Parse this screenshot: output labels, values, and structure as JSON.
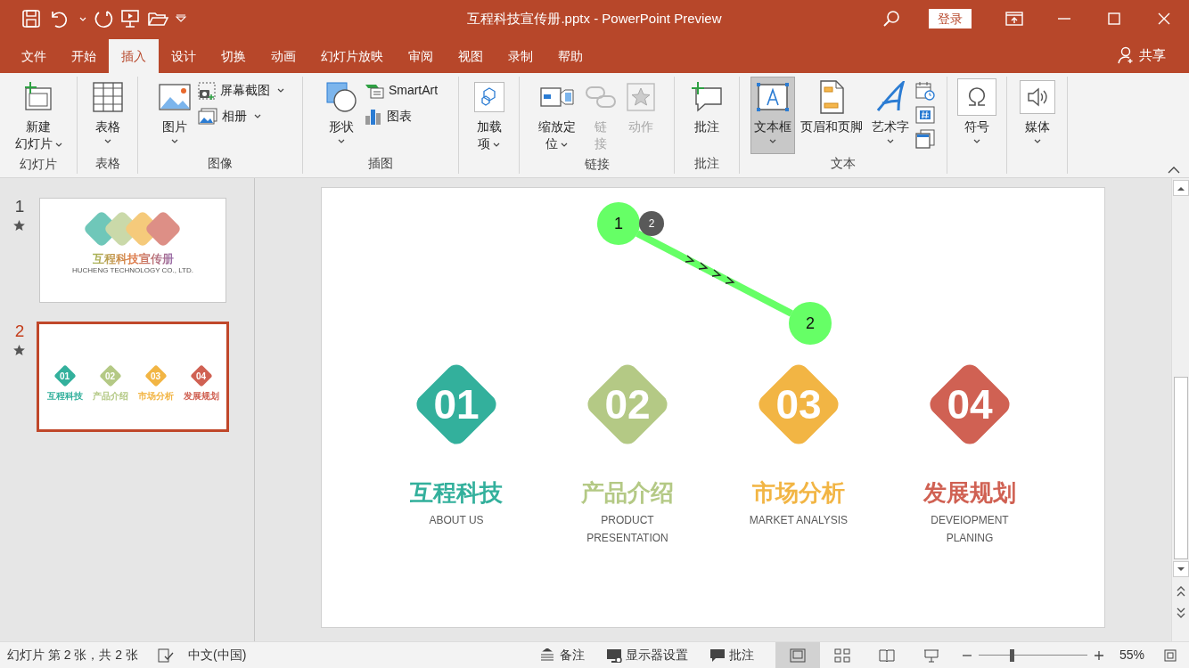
{
  "title_bar": {
    "title": "互程科技宣传册.pptx  -  PowerPoint Preview",
    "sign_in": "登录"
  },
  "menu_tabs": [
    {
      "label": "文件",
      "selected": false
    },
    {
      "label": "开始",
      "selected": false
    },
    {
      "label": "插入",
      "selected": true
    },
    {
      "label": "设计",
      "selected": false
    },
    {
      "label": "切换",
      "selected": false
    },
    {
      "label": "动画",
      "selected": false
    },
    {
      "label": "幻灯片放映",
      "selected": false
    },
    {
      "label": "审阅",
      "selected": false
    },
    {
      "label": "视图",
      "selected": false
    },
    {
      "label": "录制",
      "selected": false
    },
    {
      "label": "帮助",
      "selected": false
    }
  ],
  "share": "共享",
  "ribbon": {
    "groups": [
      {
        "label": "幻灯片",
        "buttons": [
          {
            "kind": "large",
            "label": [
              "新建",
              "幻灯片"
            ],
            "dropdown": true,
            "disabled": false,
            "selected": false
          }
        ]
      },
      {
        "label": "表格",
        "buttons": [
          {
            "kind": "large",
            "label": "表格",
            "dropdown": true,
            "disabled": false,
            "selected": false
          }
        ]
      },
      {
        "label": "图像",
        "buttons": [
          {
            "kind": "large",
            "label": "图片",
            "dropdown": true,
            "disabled": false,
            "selected": false
          },
          {
            "kind": "small",
            "label": "屏幕截图",
            "dropdown": true,
            "disabled": false,
            "selected": false
          },
          {
            "kind": "small",
            "label": "相册",
            "dropdown": true,
            "disabled": false,
            "selected": false
          }
        ]
      },
      {
        "label": "插图",
        "buttons": [
          {
            "kind": "large",
            "label": "形状",
            "dropdown": true,
            "disabled": false,
            "selected": false
          },
          {
            "kind": "small",
            "label": "SmartArt",
            "dropdown": false,
            "disabled": false,
            "selected": false
          },
          {
            "kind": "small",
            "label": "图表",
            "dropdown": false,
            "disabled": false,
            "selected": false
          }
        ]
      },
      {
        "buttons": [
          {
            "kind": "large",
            "label": [
              "加载",
              "项"
            ],
            "dropdown": true,
            "disabled": false,
            "selected": false
          }
        ]
      },
      {
        "label": "链接",
        "buttons": [
          {
            "kind": "large",
            "label": [
              "缩放定",
              "位"
            ],
            "dropdown": true,
            "disabled": false,
            "selected": false
          },
          {
            "kind": "large",
            "label": [
              "链",
              "接"
            ],
            "dropdown": false,
            "disabled": true,
            "selected": false
          },
          {
            "kind": "large",
            "label": "动作",
            "dropdown": false,
            "disabled": true,
            "selected": false
          }
        ]
      },
      {
        "label": "批注",
        "buttons": [
          {
            "kind": "large",
            "label": "批注",
            "dropdown": false,
            "disabled": false,
            "selected": false
          }
        ]
      },
      {
        "label": "文本",
        "buttons": [
          {
            "kind": "large",
            "label": "文本框",
            "dropdown": true,
            "disabled": false,
            "selected": true
          },
          {
            "kind": "large",
            "label": "页眉和页脚",
            "dropdown": false,
            "disabled": false,
            "selected": false
          },
          {
            "kind": "large",
            "label": "艺术字",
            "dropdown": true,
            "disabled": false,
            "selected": false
          },
          {
            "kind": "icon",
            "dropdown": false,
            "disabled": false,
            "selected": false
          },
          {
            "kind": "icon",
            "dropdown": false,
            "disabled": false,
            "selected": false
          },
          {
            "kind": "icon",
            "dropdown": false,
            "disabled": false,
            "selected": false
          }
        ]
      },
      {
        "buttons": [
          {
            "kind": "large",
            "label": "符号",
            "dropdown": true,
            "disabled": false,
            "selected": false
          }
        ]
      },
      {
        "buttons": [
          {
            "kind": "large",
            "label": "媒体",
            "dropdown": true,
            "disabled": false,
            "selected": false
          }
        ]
      }
    ]
  },
  "slides_panel": [
    {
      "number": "1",
      "selected": false,
      "thumbnail": {
        "kind": "cover",
        "title": "互程科技宣传册",
        "subtitle": "HUCHENG TECHNOLOGY CO., LTD."
      }
    },
    {
      "number": "2",
      "selected": true,
      "thumbnail": {
        "kind": "items",
        "items": [
          {
            "number": "01",
            "title": "互程科技",
            "color": "#33b09c"
          },
          {
            "number": "02",
            "title": "产品介绍",
            "color": "#b4c985"
          },
          {
            "number": "03",
            "title": "市场分析",
            "color": "#f2b544"
          },
          {
            "number": "04",
            "title": "发展规划",
            "color": "#d06153"
          }
        ]
      }
    }
  ],
  "slide": {
    "items": [
      {
        "number": "01",
        "title": "互程科技",
        "subtitle": "ABOUT US",
        "color": "#33b09c"
      },
      {
        "number": "02",
        "title": "产品介绍",
        "subtitle": "PRODUCT\nPRESENTATION",
        "color": "#b4c985"
      },
      {
        "number": "03",
        "title": "市场分析",
        "subtitle": "MARKET ANALYSIS",
        "color": "#f2b544"
      },
      {
        "number": "04",
        "title": "发展规划",
        "subtitle": "DEVEIOPMENT\nPLANING",
        "color": "#d06153"
      }
    ],
    "animation": {
      "start": "1",
      "end": "2",
      "badge": "2"
    }
  },
  "status_bar": {
    "slide_info": "幻灯片 第 2 张，共 2 张",
    "language": "中文(中国)",
    "buttons": [
      {
        "label": "备注"
      },
      {
        "label": "显示器设置"
      },
      {
        "label": "批注"
      }
    ],
    "views": [
      {
        "selected": true
      },
      {
        "selected": false
      },
      {
        "selected": false
      },
      {
        "selected": false
      }
    ],
    "zoom": {
      "level": 0.29,
      "reading": "55%"
    }
  }
}
